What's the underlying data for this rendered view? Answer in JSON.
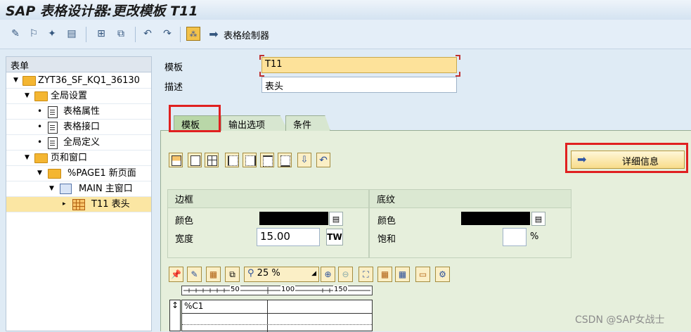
{
  "window": {
    "title": "SAP 表格设计器:更改模板 T11"
  },
  "toolbar": {
    "table_painter_label": "表格绘制器",
    "icons": [
      "display-change-icon",
      "activate-icon",
      "test-icon",
      "form-icon",
      "new-icon",
      "copy-icon",
      "undo-icon",
      "redo-icon",
      "field-list-icon",
      "arrow-right-icon"
    ]
  },
  "tree": {
    "header": "表单",
    "items": [
      {
        "label": "ZYT36_SF_KQ1_36130",
        "icon": "folder-icon"
      },
      {
        "label": "全局设置",
        "icon": "folder-icon"
      },
      {
        "label": "表格属性",
        "icon": "document-icon"
      },
      {
        "label": "表格接口",
        "icon": "document-icon"
      },
      {
        "label": "全局定义",
        "icon": "document-icon"
      },
      {
        "label": "页和窗口",
        "icon": "folder-icon"
      },
      {
        "label": "%PAGE1 新页面",
        "icon": "folder-icon"
      },
      {
        "label": "MAIN 主窗口",
        "icon": "window-icon"
      },
      {
        "label": "T11 表头",
        "icon": "table-icon",
        "selected": true
      }
    ]
  },
  "form": {
    "template_label": "模板",
    "template_value": "T11",
    "description_label": "描述",
    "description_value": "表头"
  },
  "tabs": [
    {
      "label": "模板",
      "active": true
    },
    {
      "label": "输出选项",
      "active": false
    },
    {
      "label": "条件",
      "active": false
    }
  ],
  "details_button": {
    "label": "详细信息"
  },
  "border_group": {
    "title": "边框",
    "color_label": "颜色",
    "color_value": "#000000",
    "width_label": "宽度",
    "width_value": "15.00",
    "unit": "TW"
  },
  "shading_group": {
    "title": "底纹",
    "color_label": "颜色",
    "color_value": "#000000",
    "saturation_label": "饱和",
    "saturation_value": "",
    "percent": "%"
  },
  "zoom": {
    "value": "25 %"
  },
  "ruler": {
    "marks": [
      "50",
      "100",
      "150"
    ]
  },
  "canvas": {
    "cell_label": "%C1"
  },
  "watermark": "CSDN @SAP女战士",
  "colors": {
    "highlight": "#e02020",
    "selection": "#fbe6a3",
    "input_active": "#fde29a"
  }
}
